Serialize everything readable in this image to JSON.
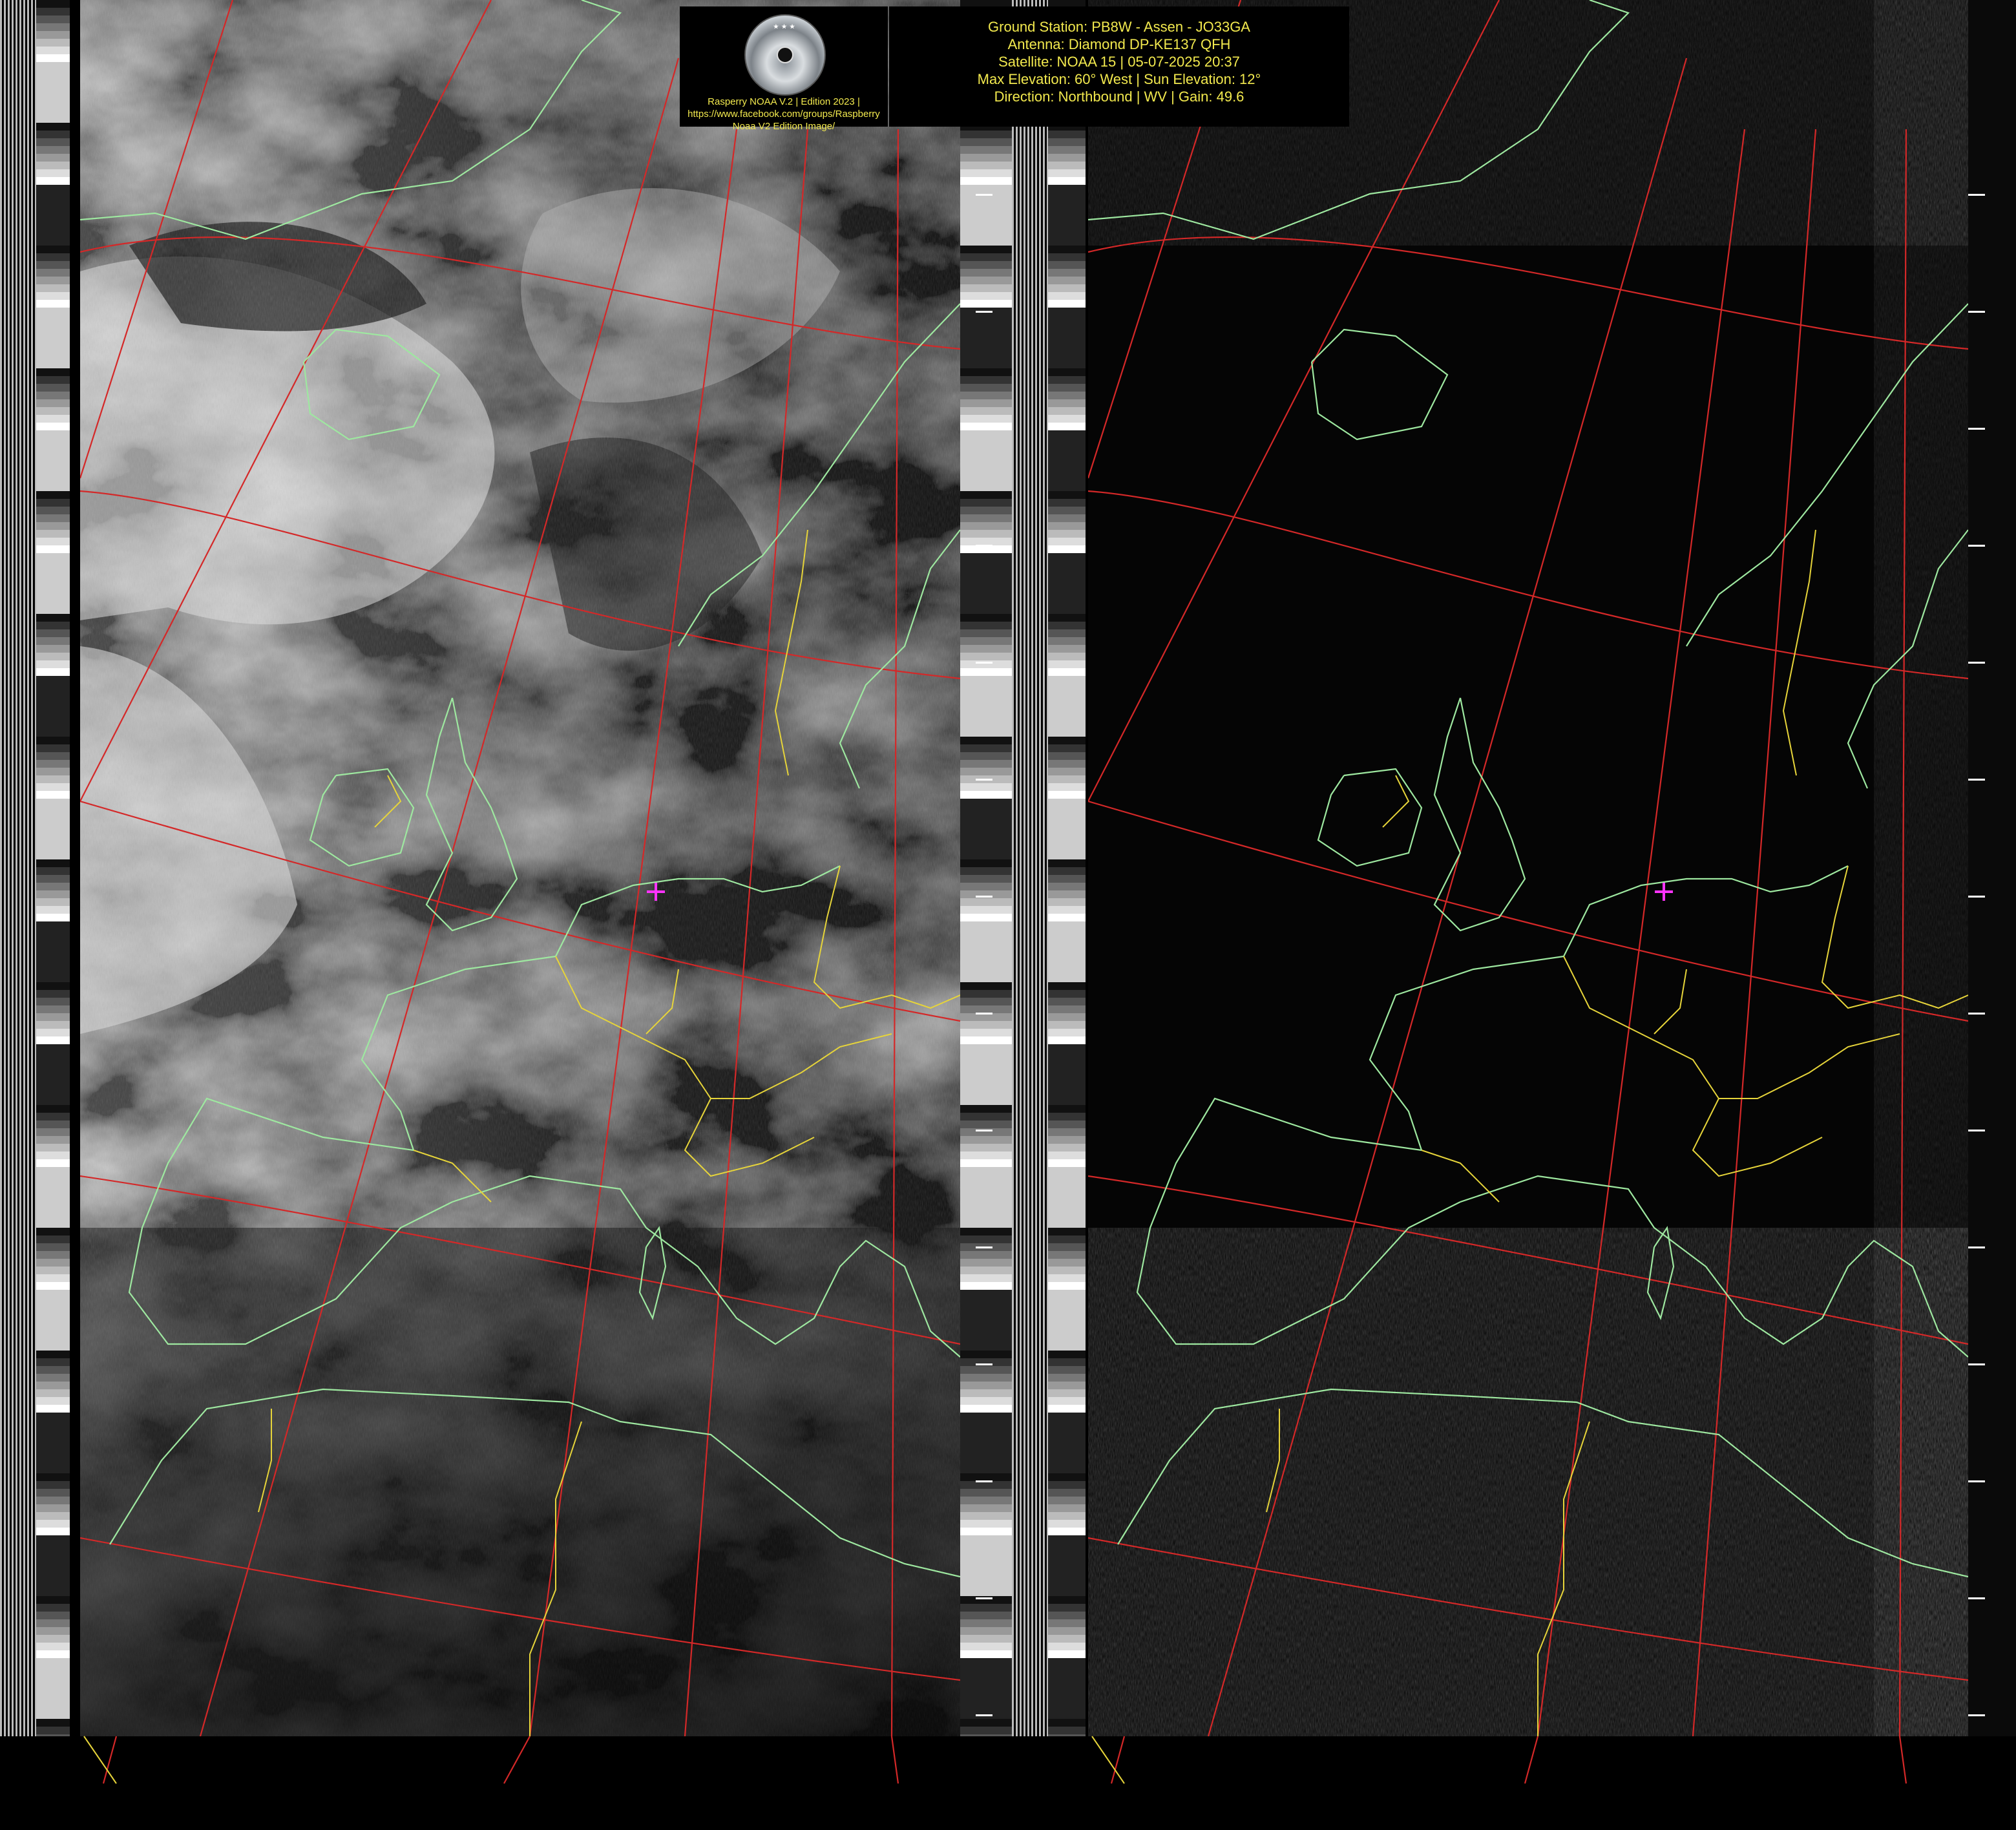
{
  "header": {
    "logo_lines": [
      "Rasperry NOAA V.2 | Edition 2023 |",
      "https://www.facebook.com/groups/Raspberry",
      "Noaa V2 Edition Image/"
    ],
    "info_lines": [
      "Ground Station: PB8W - Assen - JO33GA",
      "Antenna: Diamond DP-KE137 QFH",
      "Satellite: NOAA 15 | 05-07-2025 20:37",
      "Max Elevation: 60° West | Sun Elevation: 12°",
      "Direction: Northbound | WV | Gain: 49.6"
    ],
    "logo_icon": "satellite-disc-logo"
  },
  "panels": [
    {
      "name": "visible-channel",
      "tone": "cloud-grayscale"
    },
    {
      "name": "infrared-channel",
      "tone": "dark-noise"
    }
  ],
  "overlay": {
    "coastline_color": "#9ee8a0",
    "border_color": "#e6d43a",
    "graticule_color": "#d42828",
    "station_marker_color": "#ff33ff",
    "station_marker_icon": "crosshair-icon"
  }
}
